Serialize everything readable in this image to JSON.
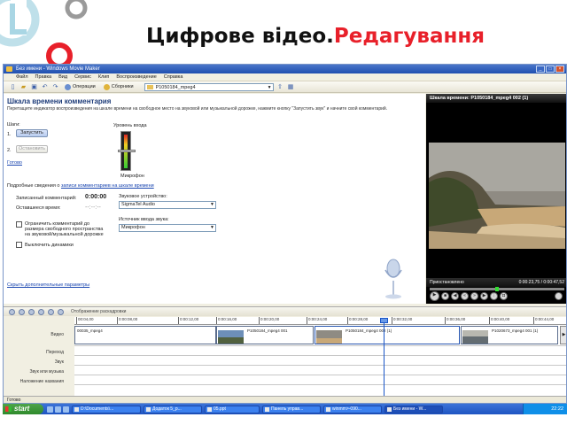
{
  "slide": {
    "title_main": "Цифрове відео.",
    "title_accent": "Редагування"
  },
  "window": {
    "title": "Без имени - Windows Movie Maker"
  },
  "menu": [
    "Файл",
    "Правка",
    "Вид",
    "Сервис",
    "Клип",
    "Воспроизведение",
    "Справка"
  ],
  "toolbar": {
    "operations": "Операции",
    "collections": "Сборники",
    "collection_value": "P1050184_mpeg4"
  },
  "narration": {
    "title": "Шкала времени комментария",
    "description": "Перетащите индикатор воспроизведения на шкале времени на свободное место на звуковой или музыкальной дорожке, нажмите кнопку \"Запустить звук\" и начните свой комментарий.",
    "steps_label": "Шаги:",
    "step1_num": "1.",
    "step2_num": "2.",
    "start_btn": "Запустить",
    "stop_btn": "Остановить",
    "done": "Готово",
    "level_label": "Уровень входа",
    "mic_label": "Микрофон",
    "details_text": "Подробные сведения о ",
    "details_link": "записи комментариев на шкале времени",
    "recorded_label": "Записанный комментарий:",
    "recorded_value": "0:00:00",
    "remaining_label": "Оставшееся время:",
    "remaining_value": "--:--:--",
    "device_label": "Звуковое устройство:",
    "device_value": "SigmaTel Audio",
    "source_label": "Источник ввода звука:",
    "source_value": "Микрофон",
    "limit_label": "Ограничить комментарий до размера свободного пространства на звуковой/музыкальной дорожке",
    "mute_label": "Выключить динамики",
    "more": "Скрыть дополнительные параметры"
  },
  "preview": {
    "title": "Шкала времени: P1050184_mpeg4 002 (1)",
    "state": "Приостановлено",
    "time": "0:00:23,75 / 0:00:47,52",
    "position_fraction": 0.5
  },
  "timeline": {
    "mode": "Отображение раскадровки",
    "ticks": [
      "00:04,00",
      "0:00:08,00",
      "0:00:12,00",
      "0:00:16,00",
      "0:00:20,00",
      "0:00:24,00",
      "0:00:28,00",
      "0:00:32,00",
      "0:00:36,00",
      "0:00:40,00",
      "0:00:44,00"
    ],
    "track_labels": [
      "Видео",
      "Переход",
      "Звук",
      "Звук или музыка",
      "Наложение названия"
    ],
    "clips": [
      "00035_mpeg4",
      "P1050184_mpeg4 001",
      "P1050184_mpeg4 002 (1)",
      "P1020673_mpeg4 001 (1)"
    ]
  },
  "status": "Готово",
  "taskbar": {
    "start": "start",
    "tasks": [
      "D:\\Documents\\...",
      "Додаток 5_р...",
      "05.ppt",
      "Панель управ...",
      "winmm>-090...",
      "Без имени - W..."
    ],
    "clock": "22:22"
  }
}
